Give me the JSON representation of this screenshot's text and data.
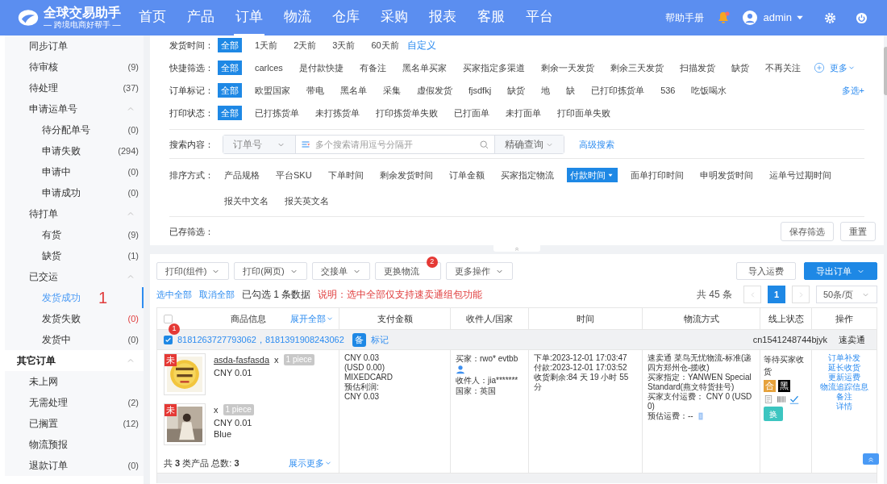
{
  "header": {
    "logo_title": "全球交易助手",
    "logo_subtitle": "— 跨境电商好帮手 —",
    "nav": [
      {
        "label": "首页",
        "selected": false
      },
      {
        "label": "产品",
        "selected": false
      },
      {
        "label": "订单",
        "selected": true
      },
      {
        "label": "物流",
        "selected": false
      },
      {
        "label": "仓库",
        "selected": false
      },
      {
        "label": "采购",
        "selected": false
      },
      {
        "label": "报表",
        "selected": false
      },
      {
        "label": "客服",
        "selected": false
      },
      {
        "label": "平台",
        "selected": false
      }
    ],
    "help": "帮助手册",
    "user": "admin"
  },
  "sidebar": {
    "items": [
      {
        "label": "同步订单",
        "selected": false
      },
      {
        "label": "待审核",
        "count": "(9)",
        "selected": false
      },
      {
        "label": "待处理",
        "count": "(37)",
        "selected": false
      },
      {
        "label": "申请运单号",
        "expanded": true,
        "selected": false,
        "children": [
          {
            "label": "待分配单号",
            "count": "(0)",
            "selected": false
          },
          {
            "label": "申请失败",
            "count": "(294)",
            "selected": false
          },
          {
            "label": "申请中",
            "count": "(0)",
            "selected": false
          },
          {
            "label": "申请成功",
            "count": "(0)",
            "selected": false
          }
        ]
      },
      {
        "label": "待打单",
        "expanded": true,
        "selected": false,
        "children": [
          {
            "label": "有货",
            "count": "(9)",
            "selected": false
          },
          {
            "label": "缺货",
            "count": "(1)",
            "selected": false
          }
        ]
      },
      {
        "label": "已交运",
        "expanded": true,
        "selected": false,
        "children": [
          {
            "label": "发货成功",
            "selected": true,
            "annotation": "1"
          },
          {
            "label": "发货失败",
            "count": "(0)",
            "alert": true,
            "selected": false
          },
          {
            "label": "发货中",
            "count": "(0)",
            "selected": false
          }
        ]
      },
      {
        "label": "其它订单",
        "kind": "section",
        "expanded": true,
        "selected": false,
        "children": [
          {
            "label": "未上网",
            "selected": false
          },
          {
            "label": "无需处理",
            "count": "(2)",
            "selected": false
          },
          {
            "label": "已搁置",
            "count": "(12)",
            "selected": false
          },
          {
            "label": "物流预报",
            "selected": false
          },
          {
            "label": "退款订单",
            "count": "(0)",
            "selected": false
          }
        ]
      }
    ]
  },
  "filters": [
    {
      "label": "发货时间：",
      "options": [
        {
          "label": "全部",
          "selected": true
        },
        {
          "label": "1天前",
          "selected": false
        },
        {
          "label": "2天前",
          "selected": false
        },
        {
          "label": "3天前",
          "selected": false
        },
        {
          "label": "60天前",
          "selected": false
        }
      ],
      "link": "自定义"
    },
    {
      "label": "快捷筛选：",
      "options": [
        {
          "label": "全部",
          "selected": true
        },
        {
          "label": "carlces",
          "selected": false
        },
        {
          "label": "是付款快捷",
          "selected": false
        },
        {
          "label": "有备注",
          "selected": false
        },
        {
          "label": "黑名单买家",
          "selected": false
        },
        {
          "label": "买家指定多渠道",
          "selected": false
        },
        {
          "label": "剩余一天发货",
          "selected": false
        },
        {
          "label": "剩余三天发货",
          "selected": false
        },
        {
          "label": "扫描发货",
          "selected": false
        },
        {
          "label": "缺货",
          "selected": false
        },
        {
          "label": "不再关注",
          "selected": false
        }
      ],
      "more": "更多"
    },
    {
      "label": "订单标记：",
      "options": [
        {
          "label": "全部",
          "selected": true
        },
        {
          "label": "欧盟国家",
          "selected": false
        },
        {
          "label": "带电",
          "selected": false
        },
        {
          "label": "黑名单",
          "selected": false
        },
        {
          "label": "采集",
          "selected": false
        },
        {
          "label": "虚假发货",
          "selected": false
        },
        {
          "label": "fjsdfkj",
          "selected": false
        },
        {
          "label": "缺货",
          "selected": false
        },
        {
          "label": "地",
          "selected": false
        },
        {
          "label": "缺",
          "selected": false
        },
        {
          "label": "已打印拣货单",
          "selected": false
        },
        {
          "label": "536",
          "selected": false
        },
        {
          "label": "吃饭喝水",
          "selected": false
        }
      ],
      "right_link": "多选+"
    },
    {
      "label": "打印状态：",
      "options": [
        {
          "label": "全部",
          "selected": true
        },
        {
          "label": "已打拣货单",
          "selected": false
        },
        {
          "label": "未打拣货单",
          "selected": false
        },
        {
          "label": "打印拣货单失败",
          "selected": false
        },
        {
          "label": "已打面单",
          "selected": false
        },
        {
          "label": "未打面单",
          "selected": false
        },
        {
          "label": "打印面单失败",
          "selected": false
        }
      ]
    }
  ],
  "search": {
    "label": "搜索内容：",
    "field": "订单号",
    "placeholder": "多个搜索请用逗号分隔开",
    "mode": "精确查询",
    "link": "高级搜索"
  },
  "sort": {
    "label": "排序方式：",
    "options": [
      {
        "label": "产品规格",
        "selected": false
      },
      {
        "label": "平台SKU",
        "selected": false
      },
      {
        "label": "下单时间",
        "selected": false
      },
      {
        "label": "剩余发货时间",
        "selected": false
      },
      {
        "label": "订单金额",
        "selected": false
      },
      {
        "label": "买家指定物流",
        "selected": false
      },
      {
        "label": "付款时间",
        "selected": true
      },
      {
        "label": "面单打印时间",
        "selected": false
      },
      {
        "label": "申明发货时间",
        "selected": false
      },
      {
        "label": "运单号过期时间",
        "selected": false
      },
      {
        "label": "报关中文名",
        "selected": false
      },
      {
        "label": "报关英文名",
        "selected": false
      }
    ]
  },
  "saved": {
    "label": "已存筛选：",
    "buttons": [
      "保存筛选",
      "重置"
    ]
  },
  "toolbar": {
    "buttons": [
      {
        "label": "打印(组件)",
        "dropdown": true
      },
      {
        "label": "打印(网页)",
        "dropdown": true
      },
      {
        "label": "交接单",
        "dropdown": true
      },
      {
        "label": "更换物流",
        "dropdown": false,
        "badge": "2"
      },
      {
        "label": "更多操作",
        "dropdown": true
      }
    ],
    "right_buttons": [
      {
        "label": "导入运费",
        "primary": false,
        "dropdown": false
      },
      {
        "label": "导出订单",
        "primary": true,
        "dropdown": true
      }
    ]
  },
  "selection": {
    "select_all": "选中全部",
    "deselect_all": "取消全部",
    "summary": "已勾选 1 条数据",
    "notice": "说明：选中全部仅支持速卖通组包功能"
  },
  "pagination": {
    "total": "共 45 条",
    "pages": [
      {
        "label": "1",
        "selected": true
      }
    ],
    "page_size": "50条/页"
  },
  "table": {
    "all_checked": false,
    "columns": [
      "商品信息",
      "支付金额",
      "收件人/国家",
      "时间",
      "物流方式",
      "线上状态",
      "操作"
    ],
    "expand_all": "展开全部",
    "order": {
      "checked": true,
      "badge": "1",
      "order_ids": "8181263727793062，8181391908243062",
      "note_tag": "备",
      "mark_link": "标记",
      "account": "cn1541248744bjyk",
      "platform": "速卖通",
      "products": [
        {
          "tag": "未",
          "title": "asda-fasfasda",
          "times": "x",
          "qty": "1 piece",
          "price": "CNY 0.01"
        },
        {
          "tag": "未",
          "times": "x",
          "qty": "1 piece",
          "price": "CNY 0.01",
          "variant": "Blue"
        }
      ],
      "summary": "共 **3** 类产品  总数: **3**",
      "show_more": "展示更多",
      "payment": [
        "CNY 0.03",
        "(USD 0.00)",
        "MIXEDCARD",
        "预估利润:",
        "CNY 0.03"
      ],
      "buyer": "买家：rwo* evtbb",
      "receiver": "收件人：jia*******",
      "country": "国家：英国",
      "times": [
        "下单:2023-12-01 17:03:47",
        "付款:2023-12-01 17:03:52",
        "收货剩余:84 天 19 小时 55 分"
      ],
      "logistics": [
        "速卖通 菜鸟无忧物流-标准(递四方郑州仓-揽收)",
        "买家指定：YANWEN Special Standard(燕文特货挂号)",
        "买家支付运费： CNY 0 (USD 0)",
        "预估运费：--"
      ],
      "status": "等待买家收货",
      "status_tags": [
        {
          "label": "合",
          "color": "#e6a23c"
        },
        {
          "label": "黑",
          "color": "#000000"
        }
      ],
      "swap_button": "换",
      "actions": [
        "订单补发",
        "延长收货",
        "更新运费",
        "物流追踪信息",
        "备注",
        "详情"
      ]
    }
  }
}
